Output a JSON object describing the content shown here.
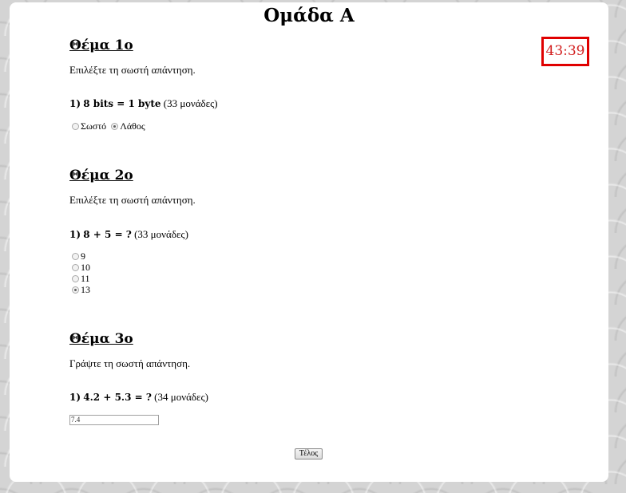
{
  "header": {
    "title": "Ομάδα Α"
  },
  "timer": {
    "value": "43:39",
    "color": "#e00000"
  },
  "sections": [
    {
      "title": "Θέμα 1ο",
      "instruction": "Επιλέξτε τη σωστή απάντηση.",
      "question": {
        "number": "1)",
        "text": "8 bits = 1 byte",
        "points": "(33 μονάδες)"
      },
      "options": [
        {
          "label": "Σωστό",
          "selected": false
        },
        {
          "label": "Λάθος",
          "selected": true
        }
      ]
    },
    {
      "title": "Θέμα 2ο",
      "instruction": "Επιλέξτε τη σωστή απάντηση.",
      "question": {
        "number": "1)",
        "text": "8 + 5 = ?",
        "points": "(33 μονάδες)"
      },
      "options": [
        {
          "label": "9",
          "selected": false
        },
        {
          "label": "10",
          "selected": false
        },
        {
          "label": "11",
          "selected": false
        },
        {
          "label": "13",
          "selected": true
        }
      ]
    },
    {
      "title": "Θέμα 3ο",
      "instruction": "Γράψτε τη σωστή απάντηση.",
      "question": {
        "number": "1)",
        "text": "4.2 + 5.3 = ?",
        "points": "(34 μονάδες)"
      },
      "answer_value": "7.4"
    }
  ],
  "footer": {
    "finish_label": "Τέλος"
  }
}
